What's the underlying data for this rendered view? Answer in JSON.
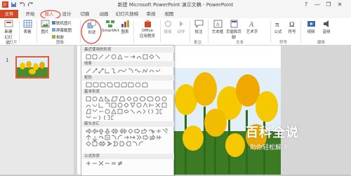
{
  "window": {
    "title": "新建 Microsoft PowerPoint 演示文稿 - PowerPoint",
    "min": "—",
    "restore": "❐",
    "close": "✕",
    "help": "?"
  },
  "tabs": [
    {
      "label": "文件"
    },
    {
      "label": "开始"
    },
    {
      "label": "插入"
    },
    {
      "label": "设计"
    },
    {
      "label": "切换"
    },
    {
      "label": "动画"
    },
    {
      "label": "幻灯片放映"
    },
    {
      "label": "审阅"
    },
    {
      "label": "视图"
    }
  ],
  "ribbon": {
    "new_slide": "新建",
    "new_slide2": "幻灯片",
    "table": "表格",
    "image": "图片",
    "online_pic": "联机图片",
    "screenshot": "屏幕截图",
    "album": "相册",
    "shapes": "形状",
    "smartart": "SmartArt",
    "chart": "图表",
    "office_apps": "Office",
    "office_apps2": "应用程序",
    "link": "链接",
    "action": "动作",
    "comment": "批注",
    "textbox": "文本框",
    "header_footer": "页眉和页脚",
    "wordart": "艺术字",
    "formula": "公式",
    "symbol": "符号",
    "video": "视频",
    "audio": "音频",
    "groups": {
      "slides": "幻灯片",
      "images": "图像",
      "comments": "批注",
      "text": "文本",
      "symbols": "符号",
      "media": "媒体"
    }
  },
  "slide_number": "1",
  "gallery": {
    "recent": "最近使用的形状",
    "lines": "线条",
    "rect": "矩形",
    "basic": "基本形状",
    "arrows": "箭头总汇",
    "formula": "公式形状"
  },
  "watermark": {
    "title": "百科全说",
    "subtitle": "助你轻松解决"
  },
  "colors": {
    "file_tab": "#d24726",
    "accent": "#e0403a",
    "tulip": "#f5c800"
  }
}
